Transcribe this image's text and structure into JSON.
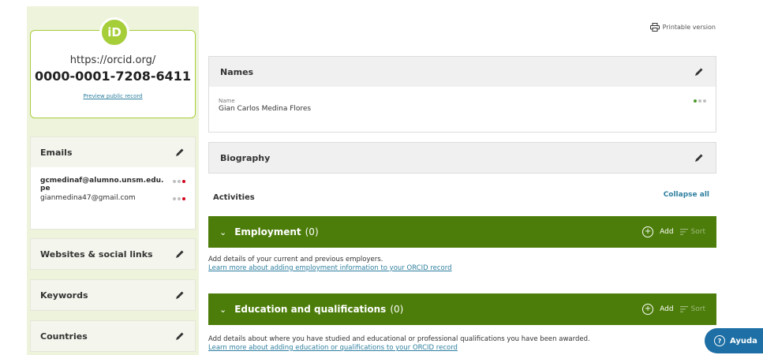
{
  "sidebar": {
    "logo_text": "iD",
    "orcid_url": "https://orcid.org/",
    "orcid_id": "0000-0001-7208-6411",
    "preview_link": "Preview public record",
    "emails": {
      "title": "Emails",
      "items": [
        {
          "line1": "gcmedinaf@alumno.unsm.edu.",
          "line2": "pe"
        },
        {
          "line1": "gianmedina47@gmail.com",
          "line2": ""
        }
      ]
    },
    "websites_title": "Websites & social links",
    "keywords_title": "Keywords",
    "countries_title": "Countries"
  },
  "header": {
    "printable": "Printable version"
  },
  "names": {
    "title": "Names",
    "field_label": "Name",
    "field_value": "Gian Carlos Medina Flores"
  },
  "biography": {
    "title": "Biography"
  },
  "activities": {
    "title": "Activities",
    "collapse_all": "Collapse all",
    "employment": {
      "title": "Employment",
      "count": "(0)",
      "add": "Add",
      "sort": "Sort",
      "help": "Add details of your current and previous employers.",
      "link": "Learn more about adding employment information to your ORCID record"
    },
    "education": {
      "title": "Education and qualifications",
      "count": "(0)",
      "add": "Add",
      "sort": "Sort",
      "help": "Add details about where you have studied and educational or professional qualifications you have been awarded.",
      "link": "Learn more about adding education or qualifications to your ORCID record"
    }
  },
  "help_widget": {
    "label": "Ayuda"
  },
  "colors": {
    "orcid_green": "#a6ce39",
    "section_green": "#4c7d0a",
    "link_blue": "#2e7f9f",
    "help_blue": "#1d6fa5"
  }
}
